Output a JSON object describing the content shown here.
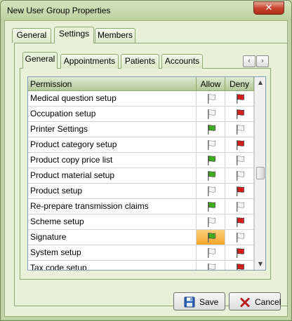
{
  "window": {
    "title": "New User Group Properties",
    "close_glyph": "✕"
  },
  "outer_tabs": [
    {
      "label": "General",
      "active": false
    },
    {
      "label": "Settings",
      "active": true
    },
    {
      "label": "Members",
      "active": false
    }
  ],
  "inner_tabs": [
    {
      "label": "General",
      "active": true
    },
    {
      "label": "Appointments",
      "active": false
    },
    {
      "label": "Patients",
      "active": false
    },
    {
      "label": "Accounts",
      "active": false
    }
  ],
  "nav": {
    "prev_glyph": "‹",
    "next_glyph": "›"
  },
  "grid": {
    "columns": {
      "permission": "Permission",
      "allow": "Allow",
      "deny": "Deny"
    },
    "rows": [
      {
        "permission": "Medical question setup",
        "allow": "off",
        "deny": "red"
      },
      {
        "permission": "Occupation setup",
        "allow": "off",
        "deny": "red"
      },
      {
        "permission": "Printer Settings",
        "allow": "green",
        "deny": "off"
      },
      {
        "permission": "Product category setup",
        "allow": "off",
        "deny": "red"
      },
      {
        "permission": "Product copy price list",
        "allow": "green",
        "deny": "off"
      },
      {
        "permission": "Product material setup",
        "allow": "green",
        "deny": "off"
      },
      {
        "permission": "Product setup",
        "allow": "off",
        "deny": "red"
      },
      {
        "permission": "Re-prepare transmission claims",
        "allow": "green",
        "deny": "off"
      },
      {
        "permission": "Scheme setup",
        "allow": "off",
        "deny": "red"
      },
      {
        "permission": "Signature",
        "allow": "green",
        "deny": "off",
        "selected": true
      },
      {
        "permission": "System setup",
        "allow": "off",
        "deny": "red"
      },
      {
        "permission": "Tax code setup",
        "allow": "off",
        "deny": "red"
      }
    ],
    "scroll_up_glyph": "▲",
    "scroll_down_glyph": "▼"
  },
  "buttons": {
    "save_label": "Save",
    "cancel_label": "Cancel"
  },
  "colors": {
    "flag_green": "#3fae1e",
    "flag_red": "#d81d1d",
    "flag_off": "#f4f4f4"
  }
}
